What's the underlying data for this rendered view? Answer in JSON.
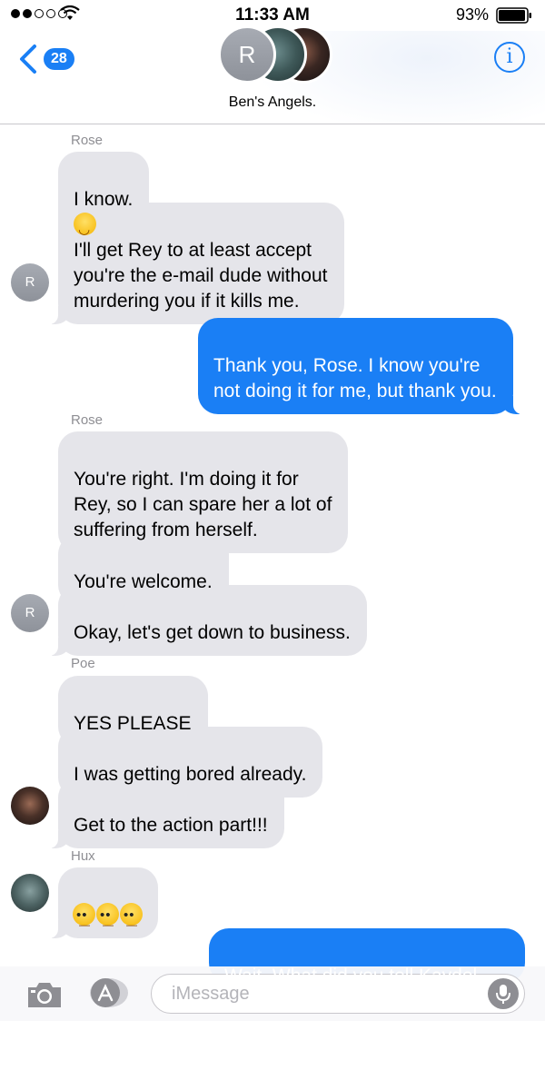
{
  "status_bar": {
    "time": "11:33 AM",
    "battery_percent": "93%"
  },
  "header": {
    "back_count": "28",
    "group_name": "Ben's Angels.",
    "group_avatar_initial": "R",
    "info_label": "i"
  },
  "messages": [
    {
      "type": "sender",
      "text": "Rose"
    },
    {
      "type": "in",
      "text": "I know.",
      "emoji": "smiling-face"
    },
    {
      "type": "in",
      "text": "I'll get Rey to at least accept\nyou're the e-mail dude without\nmurdering you if it kills me."
    },
    {
      "type": "out",
      "text": "Thank you, Rose. I know you're\nnot doing it for me, but thank you."
    },
    {
      "type": "sender",
      "text": "Rose"
    },
    {
      "type": "in",
      "text": "You're right. I'm doing it for\nRey, so I can spare her a lot of\nsuffering from herself."
    },
    {
      "type": "in",
      "text": "You're welcome."
    },
    {
      "type": "in",
      "text": "Okay, let's get down to business."
    },
    {
      "type": "sender",
      "text": "Poe"
    },
    {
      "type": "in",
      "text": "YES PLEASE"
    },
    {
      "type": "in",
      "text": "I was getting bored already."
    },
    {
      "type": "in",
      "text": "Get to the action part!!!"
    },
    {
      "type": "sender",
      "text": "Hux"
    },
    {
      "type": "in",
      "emoji": "face-with-rolling-eyes x3"
    },
    {
      "type": "out",
      "text": "Wait. What did you tell Kaydel"
    }
  ],
  "avatars": {
    "rose_initial": "R"
  },
  "input_bar": {
    "placeholder": "iMessage"
  },
  "colors": {
    "accent": "#1a7ff5",
    "incoming_bubble": "#e5e5ea",
    "outgoing_bubble": "#1a7ff5"
  }
}
